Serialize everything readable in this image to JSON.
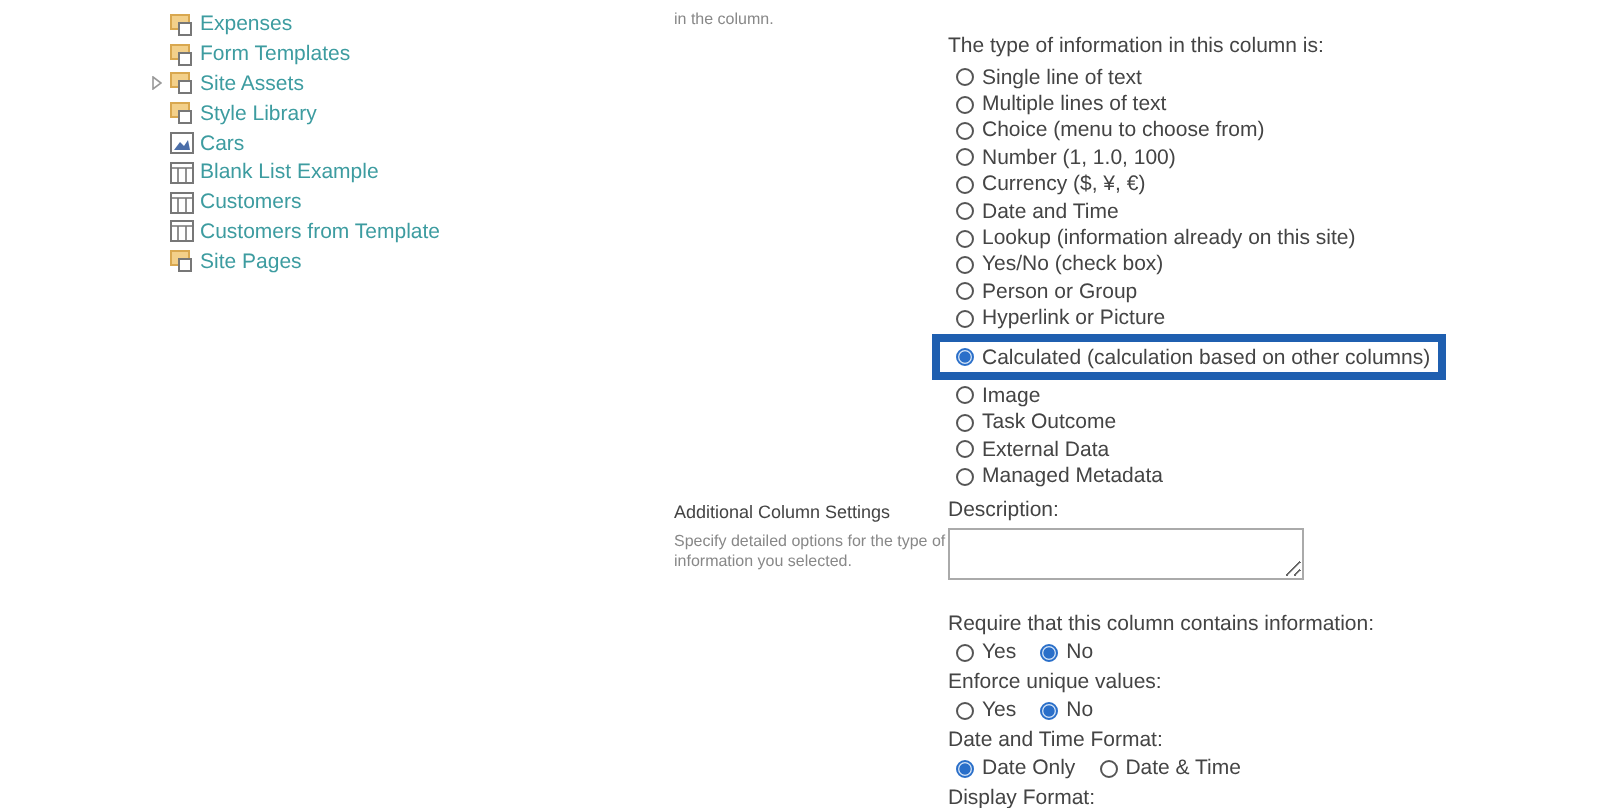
{
  "nav": {
    "items": [
      {
        "label": "Expenses",
        "kind": "library",
        "expandable": false
      },
      {
        "label": "Form Templates",
        "kind": "library",
        "expandable": false
      },
      {
        "label": "Site Assets",
        "kind": "library",
        "expandable": true
      },
      {
        "label": "Style Library",
        "kind": "library",
        "expandable": false
      },
      {
        "label": "Cars",
        "kind": "picture",
        "expandable": false
      },
      {
        "label": "Blank List Example",
        "kind": "list",
        "expandable": false
      },
      {
        "label": "Customers",
        "kind": "list",
        "expandable": false
      },
      {
        "label": "Customers from Template",
        "kind": "list",
        "expandable": false
      },
      {
        "label": "Site Pages",
        "kind": "library",
        "expandable": false
      }
    ]
  },
  "column_type": {
    "description": [
      "in the column."
    ],
    "label": "The type of information in this column is:",
    "options": [
      {
        "label": "Single line of text",
        "selected": false,
        "highlighted": false
      },
      {
        "label": "Multiple lines of text",
        "selected": false,
        "highlighted": false
      },
      {
        "label": "Choice (menu to choose from)",
        "selected": false,
        "highlighted": false
      },
      {
        "label": "Number (1, 1.0, 100)",
        "selected": false,
        "highlighted": false
      },
      {
        "label": "Currency ($, ¥, €)",
        "selected": false,
        "highlighted": false
      },
      {
        "label": "Date and Time",
        "selected": false,
        "highlighted": false
      },
      {
        "label": "Lookup (information already on this site)",
        "selected": false,
        "highlighted": false
      },
      {
        "label": "Yes/No (check box)",
        "selected": false,
        "highlighted": false
      },
      {
        "label": "Person or Group",
        "selected": false,
        "highlighted": false
      },
      {
        "label": "Hyperlink or Picture",
        "selected": false,
        "highlighted": false
      },
      {
        "label": "Calculated (calculation based on other columns)",
        "selected": true,
        "highlighted": true
      },
      {
        "label": "Image",
        "selected": false,
        "highlighted": false
      },
      {
        "label": "Task Outcome",
        "selected": false,
        "highlighted": false
      },
      {
        "label": "External Data",
        "selected": false,
        "highlighted": false
      },
      {
        "label": "Managed Metadata",
        "selected": false,
        "highlighted": false
      }
    ]
  },
  "additional_settings": {
    "title": "Additional Column Settings",
    "description": "Specify detailed options for the type of information you selected.",
    "description_label": "Description:",
    "groups": [
      {
        "label": "Require that this column contains information:",
        "options": [
          {
            "label": "Yes",
            "selected": false
          },
          {
            "label": "No",
            "selected": true
          }
        ]
      },
      {
        "label": "Enforce unique values:",
        "options": [
          {
            "label": "Yes",
            "selected": false
          },
          {
            "label": "No",
            "selected": true
          }
        ]
      },
      {
        "label": "Date and Time Format:",
        "options": [
          {
            "label": "Date Only",
            "selected": true
          },
          {
            "label": "Date & Time",
            "selected": false
          }
        ]
      },
      {
        "label": "Display Format:"
      }
    ]
  }
}
